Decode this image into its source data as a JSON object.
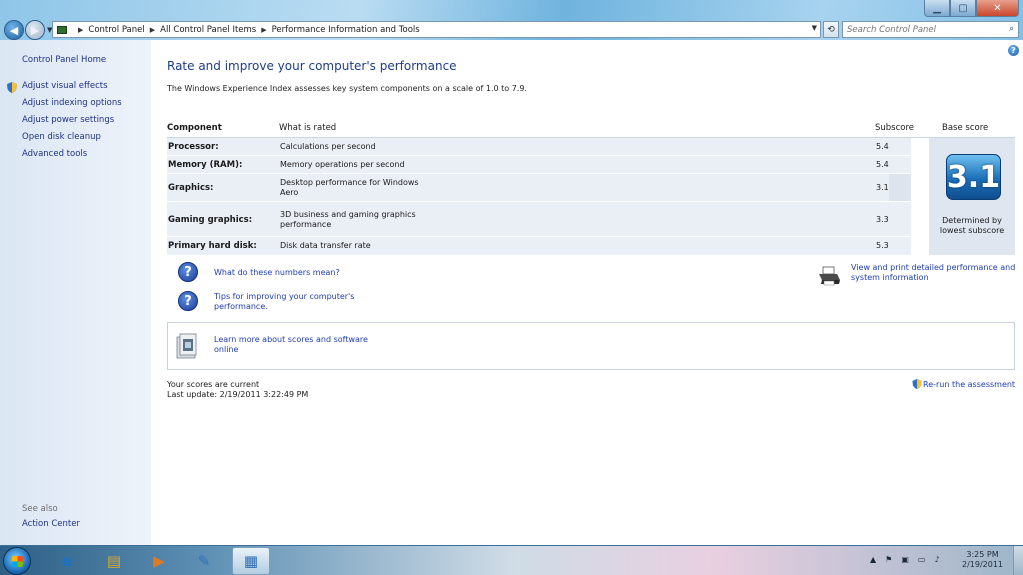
{
  "window": {
    "title": "Performance Information and Tools",
    "controls": {
      "minimize": "▁",
      "maximize": "▢",
      "close": "✕"
    }
  },
  "address": {
    "crumbs": [
      "Control Panel",
      "All Control Panel Items",
      "Performance Information and Tools"
    ],
    "search_placeholder": "Search Control Panel"
  },
  "sidebar": {
    "home": "Control Panel Home",
    "items": [
      {
        "label": "Adjust visual effects",
        "icon": "shield-icon"
      },
      {
        "label": "Adjust indexing options"
      },
      {
        "label": "Adjust power settings"
      },
      {
        "label": "Open disk cleanup"
      },
      {
        "label": "Advanced tools"
      }
    ],
    "see_also": "See also",
    "action_center": "Action Center"
  },
  "main": {
    "title": "Rate and improve your computer's performance",
    "description": "The Windows Experience Index assesses key system components on a scale of 1.0 to 7.9.",
    "table": {
      "headers": {
        "component": "Component",
        "what": "What is rated",
        "subscore": "Subscore",
        "base": "Base score"
      },
      "rows": [
        {
          "component": "Processor:",
          "what": "Calculations per second",
          "subscore": "5.4"
        },
        {
          "component": "Memory (RAM):",
          "what": "Memory operations per second",
          "subscore": "5.4"
        },
        {
          "component": "Graphics:",
          "what": "Desktop performance for Windows Aero",
          "subscore": "3.1"
        },
        {
          "component": "Gaming graphics:",
          "what": "3D business and gaming graphics performance",
          "subscore": "3.3"
        },
        {
          "component": "Primary hard disk:",
          "what": "Disk data transfer rate",
          "subscore": "5.3"
        }
      ],
      "base_score": "3.1",
      "base_caption": "Determined by lowest subscore"
    },
    "links": {
      "numbers": "What do these numbers mean?",
      "tips": "Tips for improving your computer's performance.",
      "print": "View and print detailed performance and system information",
      "learn": "Learn more about scores and software online",
      "rerun": "Re-run the assessment"
    },
    "status": {
      "current": "Your scores are current",
      "last_update": "Last update: 2/19/2011 3:22:49 PM"
    }
  },
  "taskbar": {
    "clock_time": "3:25 PM",
    "clock_date": "2/19/2011"
  },
  "colors": {
    "link": "#1e3cb4",
    "title": "#1e3c8c",
    "sidebar_link": "#1e3287"
  }
}
